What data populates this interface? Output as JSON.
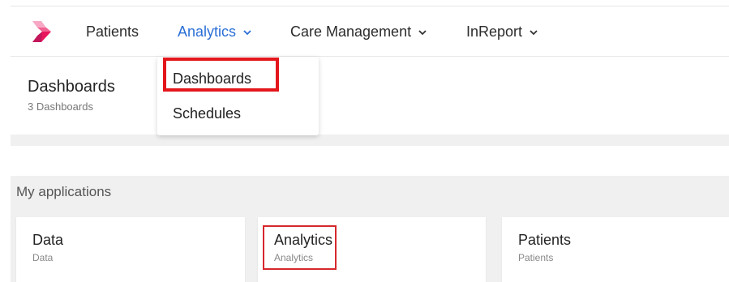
{
  "nav": {
    "patients": "Patients",
    "analytics": "Analytics",
    "care_management": "Care Management",
    "inreport": "InReport",
    "active_color": "#2a6fd6"
  },
  "subheader": {
    "title": "Dashboards",
    "subtitle": "3 Dashboards"
  },
  "dropdown": {
    "items": [
      "Dashboards",
      "Schedules"
    ],
    "highlight_color": "#e3161b"
  },
  "apps": {
    "section_label": "My applications",
    "cards": [
      {
        "title": "Data",
        "subtitle": "Data"
      },
      {
        "title": "Analytics",
        "subtitle": "Analytics"
      },
      {
        "title": "Patients",
        "subtitle": "Patients"
      }
    ]
  },
  "icons": {
    "logo": "brand-logo-icon",
    "chevron": "chevron-down-icon"
  }
}
